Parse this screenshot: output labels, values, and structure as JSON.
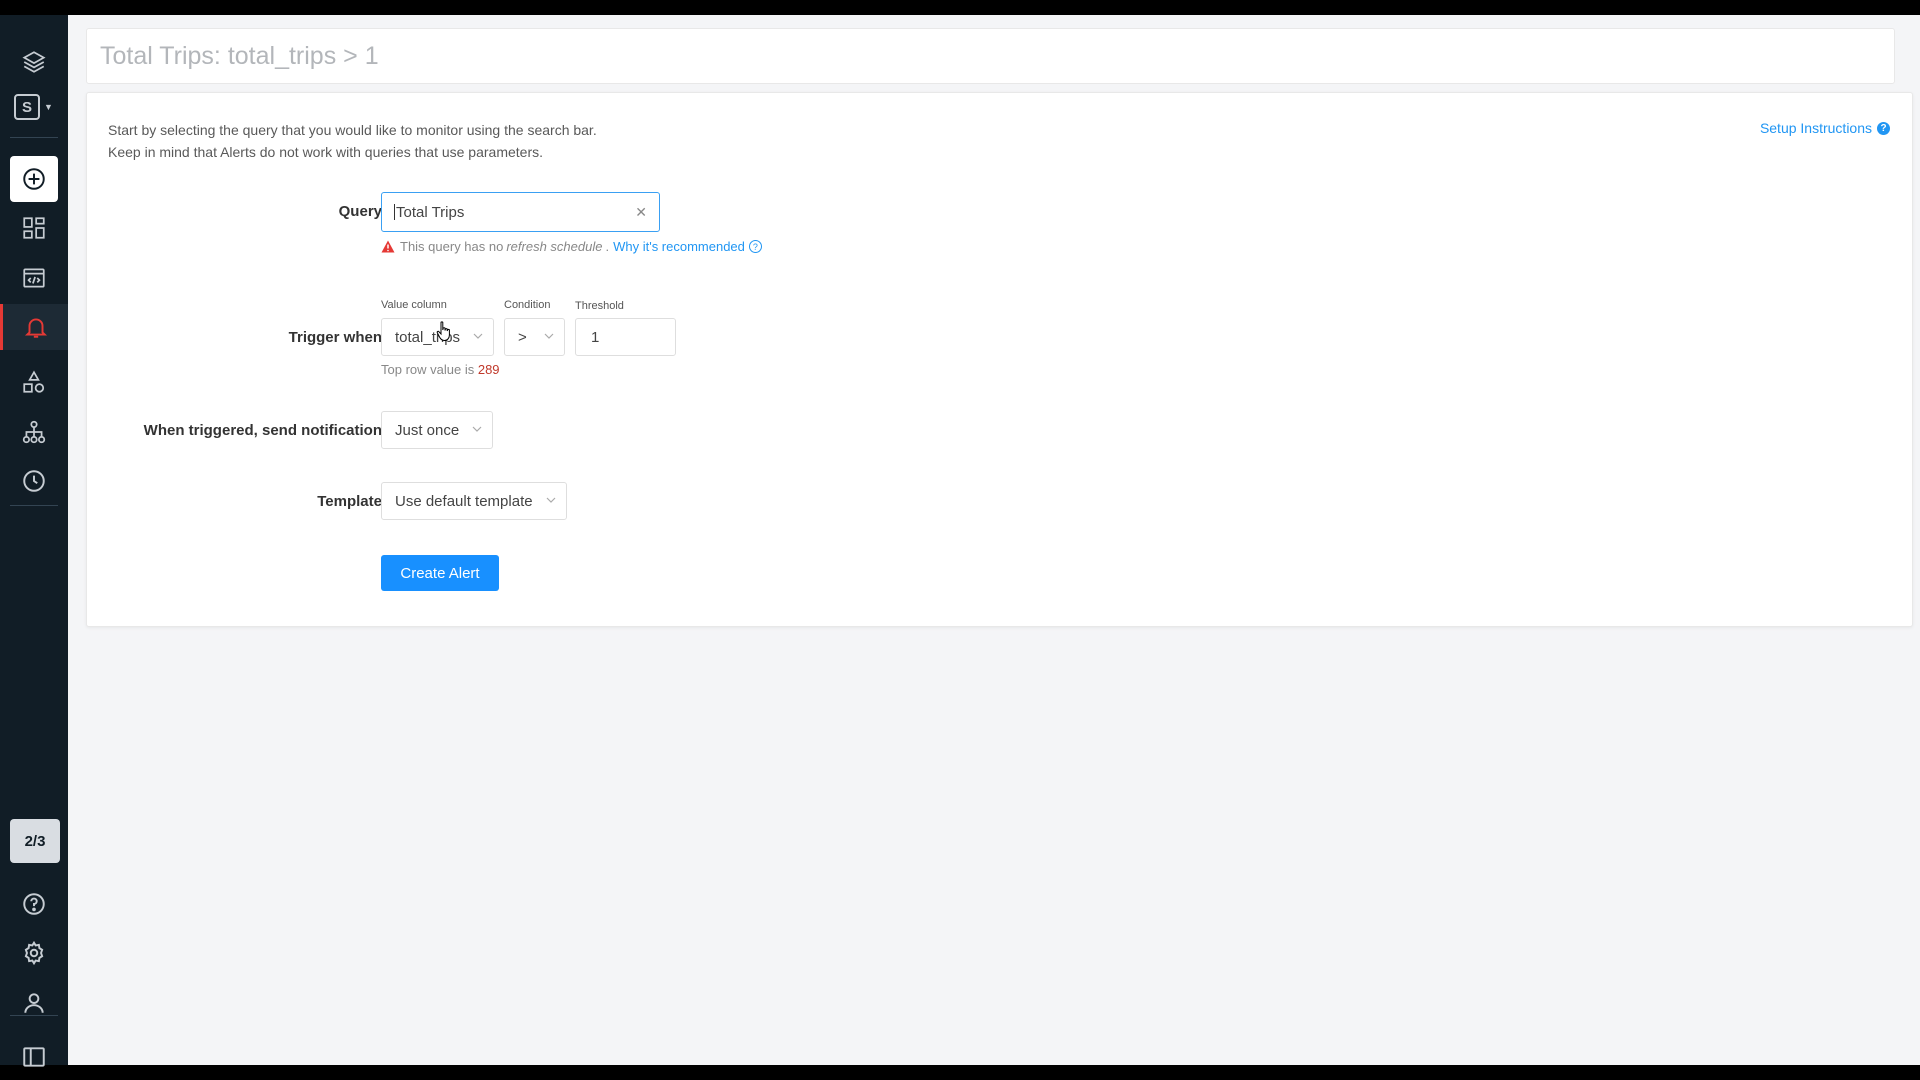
{
  "title": "Total Trips: total_trips > 1",
  "intro": {
    "line1": "Start by selecting the query that you would like to monitor using the search bar.",
    "line2": "Keep in mind that Alerts do not work with queries that use parameters."
  },
  "setup_link": "Setup Instructions",
  "sidebar": {
    "org_letter": "S",
    "counter": "2/3",
    "items": [
      "layers-icon",
      "create-icon",
      "dashboards-icon",
      "queries-icon",
      "alerts-icon",
      "shapes-icon",
      "data-sources-icon",
      "history-icon",
      "help-icon",
      "settings-icon",
      "user-icon",
      "panel-icon"
    ]
  },
  "form": {
    "query_label": "Query",
    "query_value": "Total Trips",
    "warning_prefix": "This query has no",
    "warning_em": "refresh schedule",
    "warning_suffix": ".",
    "warning_link": "Why it's recommended",
    "trigger_label": "Trigger when",
    "value_column_label": "Value column",
    "value_column": "total_trips",
    "condition_label": "Condition",
    "condition": ">",
    "threshold_label": "Threshold",
    "threshold": "1",
    "top_row_prefix": "Top row value is",
    "top_row_value": "289",
    "notify_label": "When triggered, send notification",
    "notify_value": "Just once",
    "template_label": "Template",
    "template_value": "Use default template",
    "create_button": "Create Alert"
  },
  "colors": {
    "sidebar_bg": "#111d26",
    "accent": "#1890ff",
    "alert_red": "#e53935"
  }
}
